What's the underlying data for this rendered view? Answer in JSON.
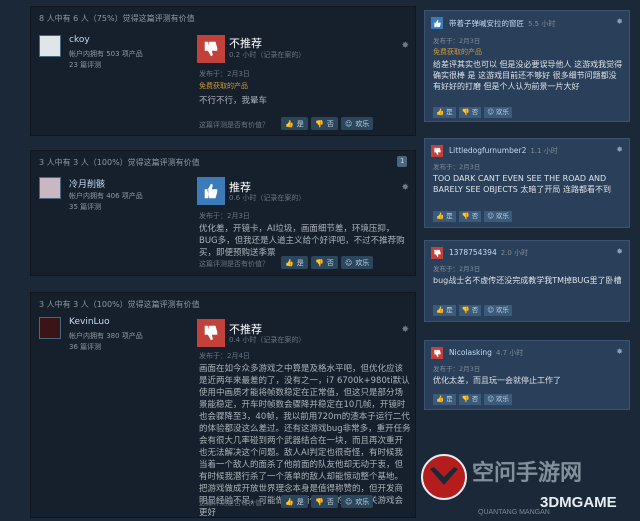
{
  "reviews": [
    {
      "helpful": "8 人中有 6 人（75%）觉得这篇评测有价值",
      "user": "ckoy",
      "products": "帐户内拥有 503 项产品",
      "count": "23 篇评测",
      "verdict": "不推荐",
      "hours": "0.2 小时（记录在案的）",
      "date": "发布于：2月3日",
      "free": "免费获取的产品",
      "text": "不行不行，我晕车",
      "question": "这篇评测是否有价值？",
      "yes": "是",
      "no": "否",
      "funny": "欢乐"
    },
    {
      "helpful": "3 人中有 3 人（100%）觉得这篇评测有价值",
      "badge": "1",
      "user": "冷月削骸",
      "products": "帐户内拥有 406 项产品",
      "count": "35 篇评测",
      "verdict": "推荐",
      "hours": "0.6 小时（记录在案的）",
      "date": "发布于：2月3日",
      "text": "优化差，开镜卡，AI垃圾，画面细节差，环境压抑，BUG多，但我还是人道主义给个好评吧，不过不推荐购买，即便预购送季票",
      "question": "这篇评测是否有价值？",
      "yes": "是",
      "no": "否",
      "funny": "欢乐"
    },
    {
      "helpful": "3 人中有 3 人（100%）觉得这篇评测有价值",
      "user": "KevinLuo",
      "products": "帐户内拥有 380 项产品",
      "count": "36 篇评测",
      "verdict": "不推荐",
      "hours": "0.4 小时（记录在案的）",
      "date": "发布于：2月4日",
      "text": "画面在如今众多游戏之中算是及格水平吧，但优化应该是近两年来最差的了，没有之一，i7 6700k+980ti默认使用中画质才能将帧数稳定在正常值，但这只是部分场景能稳定，开车时帧数会骤降并稳定在10几帧，开镜时也会骤降至3，40帧，我以前用720m的渣本子运行二代的体验都没这么差过。还有这游戏bug非常多，重开任务会有很大几率碰到两个武器结合在一块，而且再次重开也无法解决这个问题。敌人AI判定也很奇怪，有时候我当着一个敌人的面杀了他前面的队友他却无动于衷，但有时候我潜行杀了一个落单的敌人却能惊动整个基地。\n把游戏做成开放世界理念本身是值得称赞的，但开发商明显经验不足，可能做成前两代那样的线性通关游戏会更好",
      "question": "这篇评测是否有价值？",
      "yes": "是",
      "no": "否",
      "funny": "欢乐"
    }
  ],
  "side_cards": [
    {
      "user": "带着子弹喊安拉的窗匠",
      "hours": "5.5 小时",
      "date": "发布于：2月3日",
      "free": "免费获取的产品",
      "text": "给差评其实也可以 但是没必要误导他人 这游戏我觉得确实很棒 是 这游戏目前还不够好 很多细节问题都没有好好的打磨 但是个人认为前景一片大好",
      "yes": "是",
      "no": "否",
      "funny": "欢乐"
    },
    {
      "user": "Littledogfurnumber2",
      "hours": "1.1 小时",
      "date": "发布于：2月3日",
      "text": "TOO DARK CANT EVEN SEE THE ROAD AND BARELY SEE OBJECTS 太暗了开局 连路都看不到",
      "yes": "是",
      "no": "否",
      "funny": "欢乐"
    },
    {
      "user": "1378754394",
      "hours": "2.0 小时",
      "date": "发布于：2月3日",
      "text": "bug战士名不虚传还没完成教学我TM掉BUG里了卧槽",
      "yes": "是",
      "no": "否",
      "funny": "欢乐"
    },
    {
      "user": "Nicolasking",
      "hours": "4.7 小时",
      "date": "发布于：2月3日",
      "text": "优化太差，而且玩一会就停止工作了",
      "yes": "是",
      "no": "否",
      "funny": "欢乐"
    }
  ],
  "watermark": {
    "cn": "空问手游网",
    "brand": "3DMGAME",
    "sub": "QUANTANG MANGAN"
  },
  "colors": {
    "down": "#c2413a",
    "up": "#3d7bb8",
    "bg": "#1b2838"
  }
}
